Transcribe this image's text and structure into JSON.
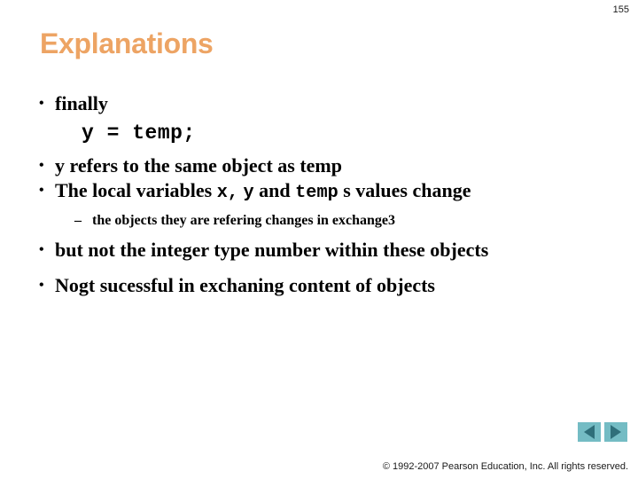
{
  "slide": {
    "page_number": "155",
    "title": "Explanations",
    "title_color": "#eda464",
    "background_color": "#ffffff",
    "text_color": "#000000"
  },
  "content": {
    "bullets": [
      {
        "level": 1,
        "marker": "•",
        "parts": [
          {
            "text": "finally",
            "style": "serif"
          }
        ]
      },
      {
        "level": "code",
        "text": "y = temp;"
      },
      {
        "level": 1,
        "marker": "•",
        "parts": [
          {
            "text": "y refers to the same object as temp",
            "style": "serif"
          }
        ]
      },
      {
        "level": 1,
        "marker": "•",
        "parts": [
          {
            "text": "The local variables ",
            "style": "serif"
          },
          {
            "text": "x,",
            "style": "mono"
          },
          {
            "text": "  ",
            "style": "serif"
          },
          {
            "text": "y",
            "style": "mono"
          },
          {
            "text": " and ",
            "style": "serif"
          },
          {
            "text": "temp",
            "style": "mono"
          },
          {
            "text": " s values change",
            "style": "serif"
          }
        ]
      },
      {
        "level": 2,
        "marker": "–",
        "parts": [
          {
            "text": "the objects they are refering changes in exchange3",
            "style": "serif"
          }
        ]
      },
      {
        "level": 1,
        "marker": "•",
        "parts": [
          {
            "text": "but not the integer type number within these objects",
            "style": "serif"
          }
        ]
      },
      {
        "level": 1,
        "marker": "•",
        "parts": [
          {
            "text": "Nogt sucessful in exchaning content of objects",
            "style": "serif"
          }
        ]
      }
    ]
  },
  "navigation": {
    "previous_label": "◀",
    "next_label": "▶",
    "button_color": "#74bcc4",
    "arrow_color": "#2f6f7a"
  },
  "footer": {
    "copyright": "© 1992-2007 Pearson Education, Inc.  All rights reserved."
  }
}
